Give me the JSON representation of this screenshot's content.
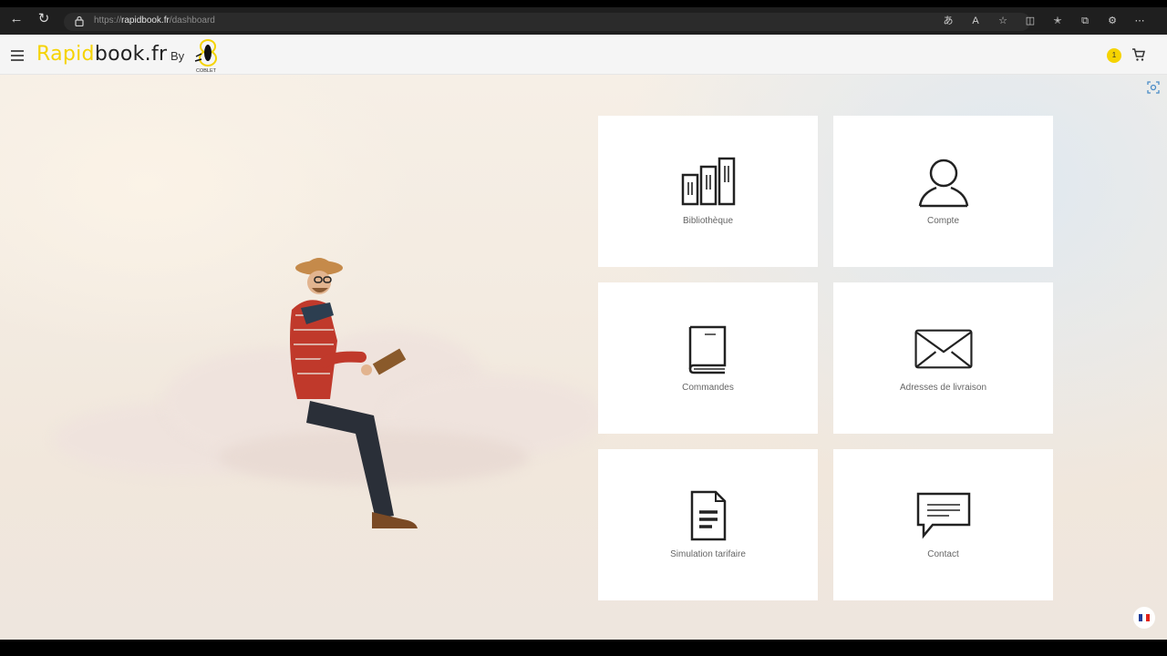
{
  "browser": {
    "url_scheme": "https://",
    "url_host": "rapidbook.fr",
    "url_path": "/dashboard"
  },
  "header": {
    "logo_part1": "Rapid",
    "logo_part2": "book.fr",
    "by_label": "By",
    "coblet_label": "COBLET",
    "cart_badge": "1"
  },
  "cards": [
    {
      "label": "Bibliothèque",
      "icon": "books-icon"
    },
    {
      "label": "Compte",
      "icon": "user-icon"
    },
    {
      "label": "Commandes",
      "icon": "book-icon"
    },
    {
      "label": "Adresses de livraison",
      "icon": "envelope-icon"
    },
    {
      "label": "Simulation tarifaire",
      "icon": "document-icon"
    },
    {
      "label": "Contact",
      "icon": "chat-icon"
    }
  ],
  "colors": {
    "brand_yellow": "#f5d300",
    "icon_dark": "#222222",
    "card_bg": "#ffffff"
  }
}
